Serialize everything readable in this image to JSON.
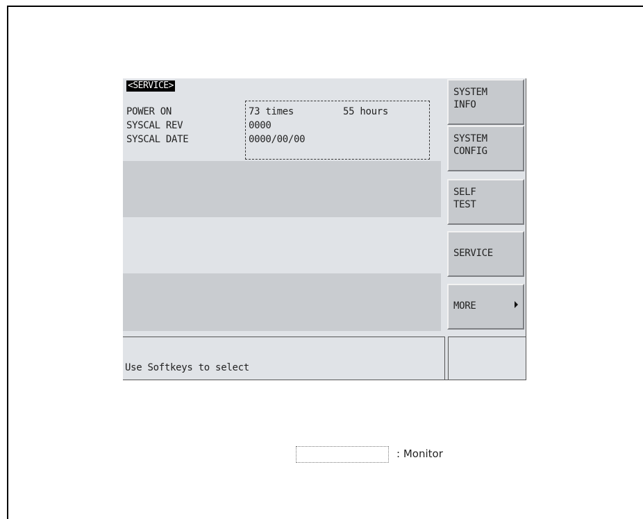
{
  "screen": {
    "title_tag": "<SERVICE>",
    "rows": [
      {
        "label": "POWER ON",
        "value_times": "73 times",
        "value_hours": "55 hours"
      },
      {
        "label": "SYSCAL REV",
        "value": "0000"
      },
      {
        "label": "SYSCAL DATE",
        "value": "0000/00/00"
      }
    ],
    "status_message": "Use Softkeys to select"
  },
  "softkeys": [
    {
      "line1": "SYSTEM",
      "line2": "INFO"
    },
    {
      "line1": "SYSTEM",
      "line2": "CONFIG"
    },
    {
      "line1": "SELF",
      "line2": "TEST"
    },
    {
      "line1": "SERVICE",
      "line2": ""
    },
    {
      "line1": "MORE",
      "line2": "",
      "icon": "right-triangle-icon"
    }
  ],
  "legend": {
    "separator": ":",
    "label": "Monitor"
  }
}
